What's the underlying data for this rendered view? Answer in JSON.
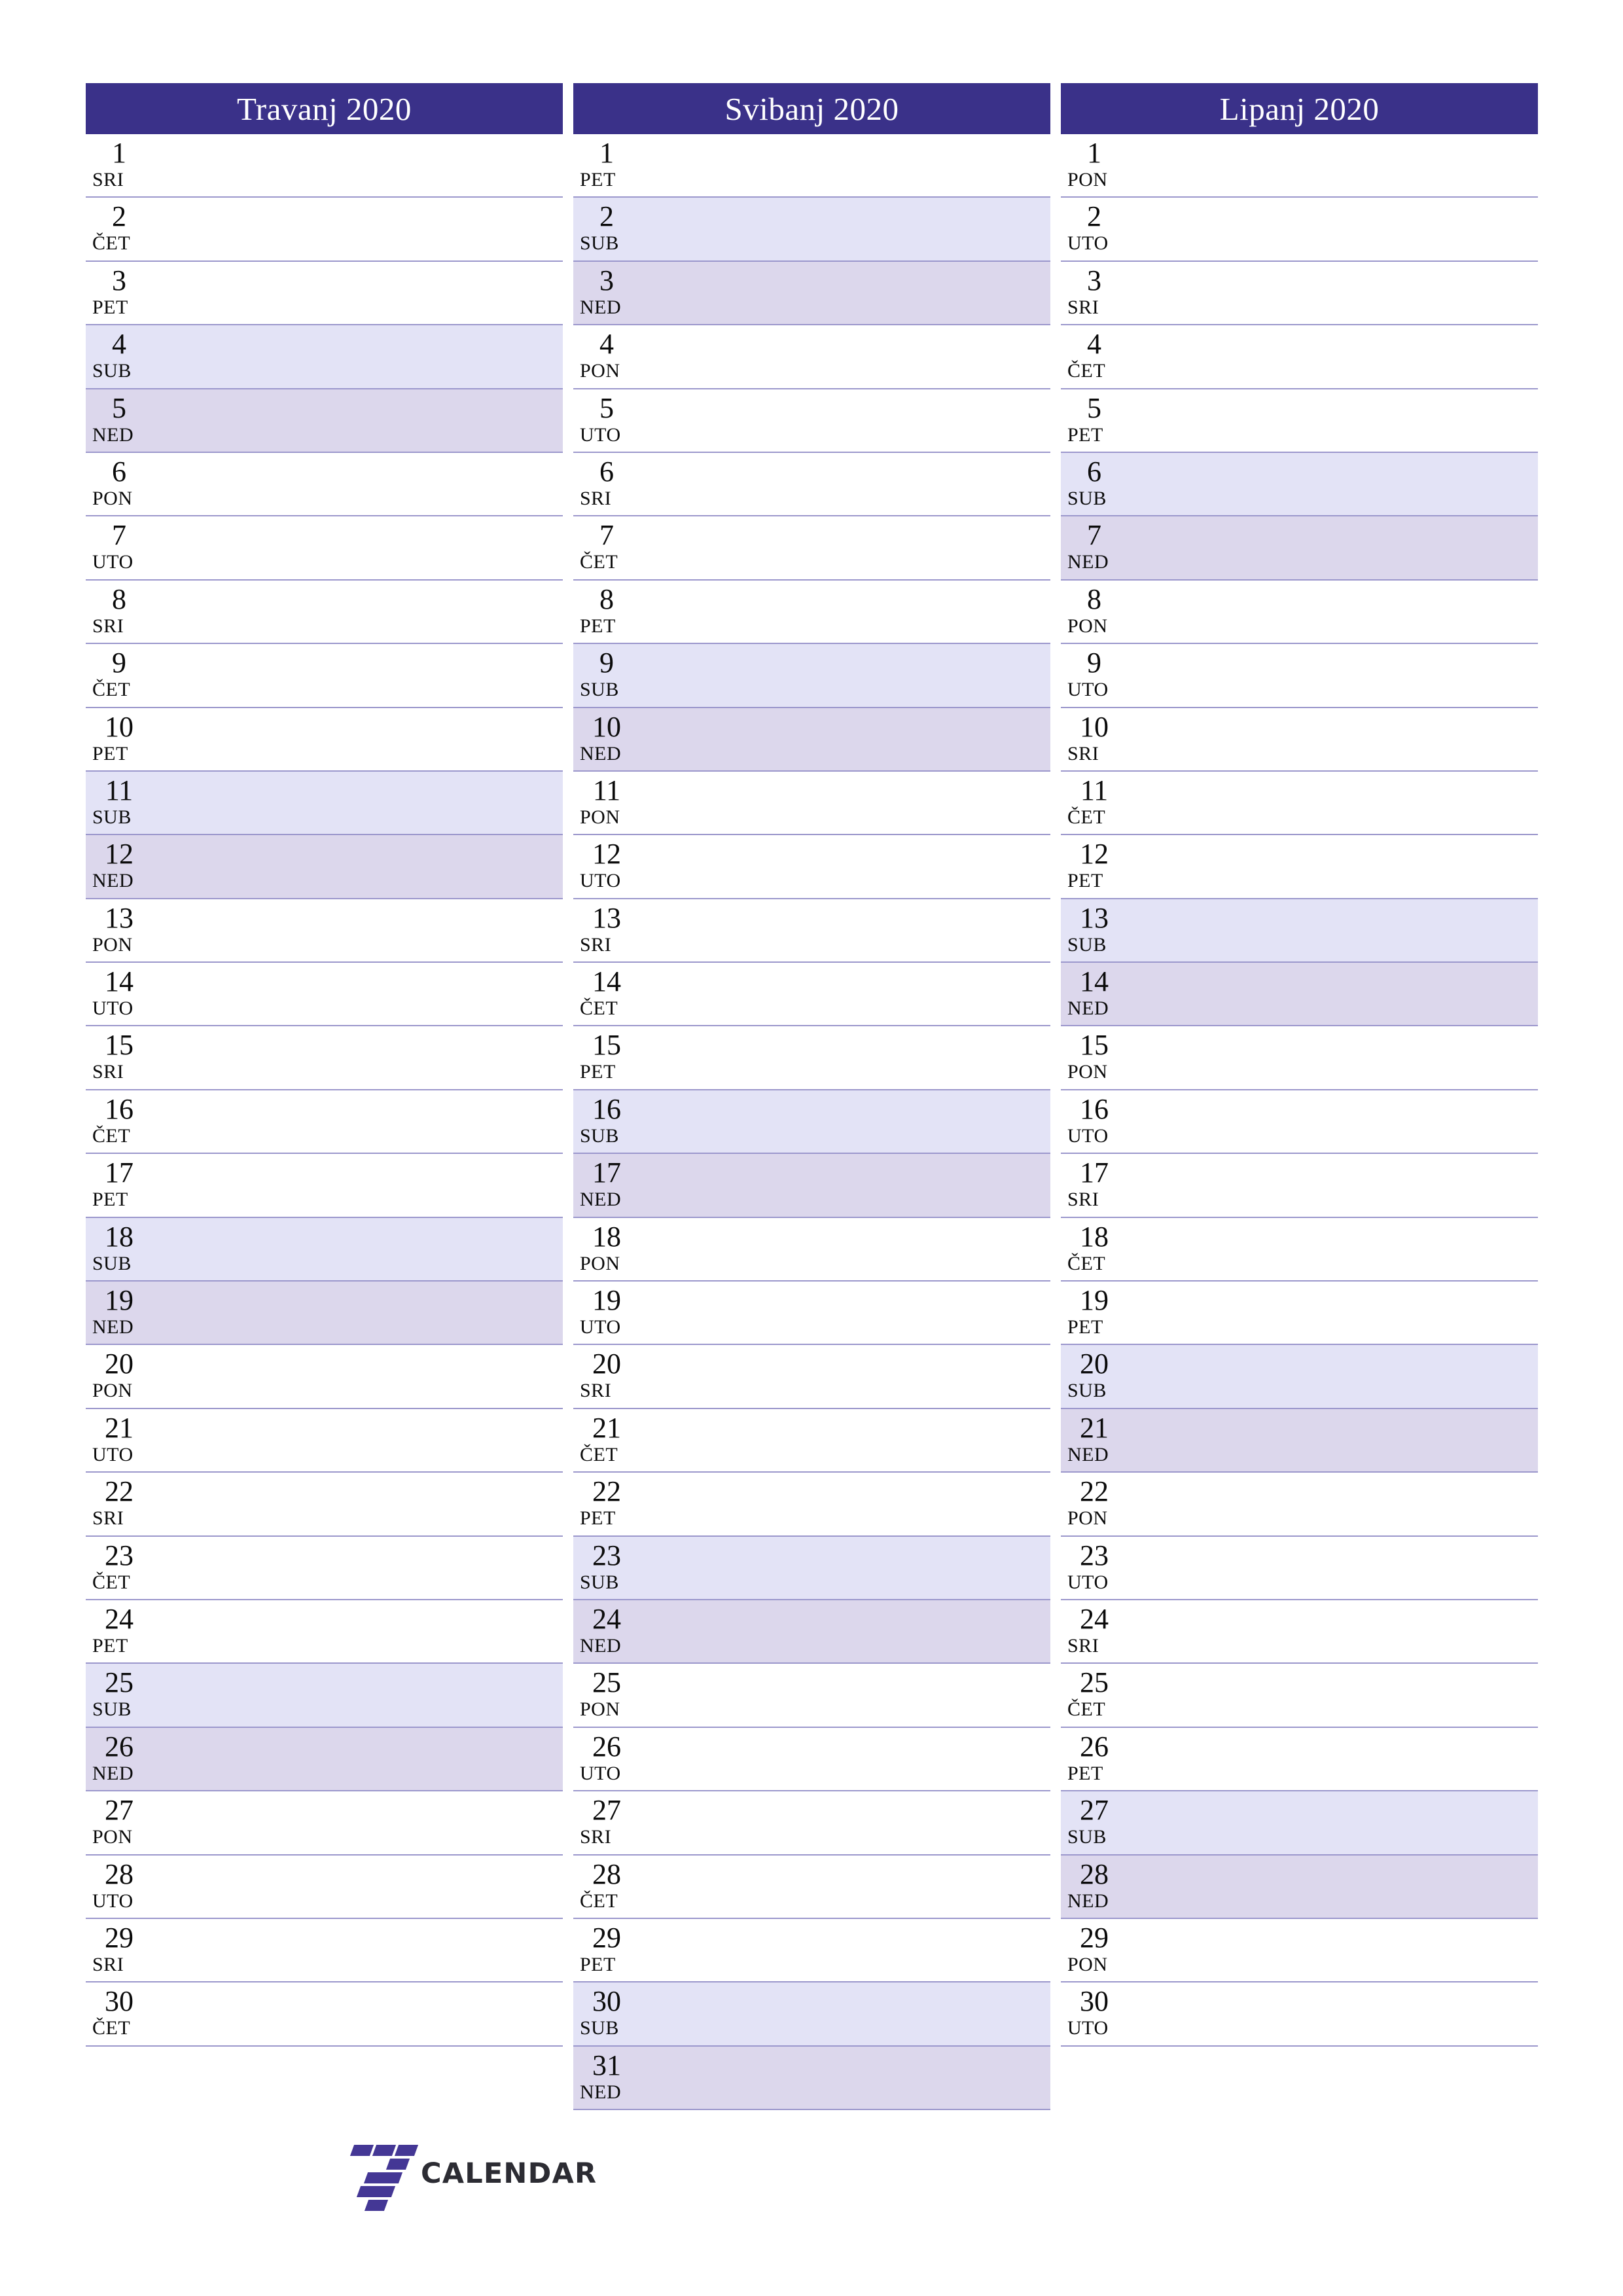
{
  "page": {
    "accent_color": "#3a3189",
    "saturday_color": "#e3e3f6",
    "sunday_color": "#dcd7ec",
    "row_separator_color": "#9b97cc",
    "text_color": "#0b0b0b"
  },
  "brand": {
    "name": "CALENDAR",
    "mark_colors": [
      "#f4003c",
      "#443795"
    ],
    "mark_icon": "seven-blocks-icon"
  },
  "months": [
    {
      "title": "Travanj 2020",
      "days": [
        {
          "num": "1",
          "weekday": "SRI",
          "type": "weekday"
        },
        {
          "num": "2",
          "weekday": "ČET",
          "type": "weekday"
        },
        {
          "num": "3",
          "weekday": "PET",
          "type": "weekday"
        },
        {
          "num": "4",
          "weekday": "SUB",
          "type": "saturday"
        },
        {
          "num": "5",
          "weekday": "NED",
          "type": "sunday"
        },
        {
          "num": "6",
          "weekday": "PON",
          "type": "weekday"
        },
        {
          "num": "7",
          "weekday": "UTO",
          "type": "weekday"
        },
        {
          "num": "8",
          "weekday": "SRI",
          "type": "weekday"
        },
        {
          "num": "9",
          "weekday": "ČET",
          "type": "weekday"
        },
        {
          "num": "10",
          "weekday": "PET",
          "type": "weekday"
        },
        {
          "num": "11",
          "weekday": "SUB",
          "type": "saturday"
        },
        {
          "num": "12",
          "weekday": "NED",
          "type": "sunday"
        },
        {
          "num": "13",
          "weekday": "PON",
          "type": "weekday"
        },
        {
          "num": "14",
          "weekday": "UTO",
          "type": "weekday"
        },
        {
          "num": "15",
          "weekday": "SRI",
          "type": "weekday"
        },
        {
          "num": "16",
          "weekday": "ČET",
          "type": "weekday"
        },
        {
          "num": "17",
          "weekday": "PET",
          "type": "weekday"
        },
        {
          "num": "18",
          "weekday": "SUB",
          "type": "saturday"
        },
        {
          "num": "19",
          "weekday": "NED",
          "type": "sunday"
        },
        {
          "num": "20",
          "weekday": "PON",
          "type": "weekday"
        },
        {
          "num": "21",
          "weekday": "UTO",
          "type": "weekday"
        },
        {
          "num": "22",
          "weekday": "SRI",
          "type": "weekday"
        },
        {
          "num": "23",
          "weekday": "ČET",
          "type": "weekday"
        },
        {
          "num": "24",
          "weekday": "PET",
          "type": "weekday"
        },
        {
          "num": "25",
          "weekday": "SUB",
          "type": "saturday"
        },
        {
          "num": "26",
          "weekday": "NED",
          "type": "sunday"
        },
        {
          "num": "27",
          "weekday": "PON",
          "type": "weekday"
        },
        {
          "num": "28",
          "weekday": "UTO",
          "type": "weekday"
        },
        {
          "num": "29",
          "weekday": "SRI",
          "type": "weekday"
        },
        {
          "num": "30",
          "weekday": "ČET",
          "type": "weekday"
        }
      ]
    },
    {
      "title": "Svibanj 2020",
      "days": [
        {
          "num": "1",
          "weekday": "PET",
          "type": "weekday"
        },
        {
          "num": "2",
          "weekday": "SUB",
          "type": "saturday"
        },
        {
          "num": "3",
          "weekday": "NED",
          "type": "sunday"
        },
        {
          "num": "4",
          "weekday": "PON",
          "type": "weekday"
        },
        {
          "num": "5",
          "weekday": "UTO",
          "type": "weekday"
        },
        {
          "num": "6",
          "weekday": "SRI",
          "type": "weekday"
        },
        {
          "num": "7",
          "weekday": "ČET",
          "type": "weekday"
        },
        {
          "num": "8",
          "weekday": "PET",
          "type": "weekday"
        },
        {
          "num": "9",
          "weekday": "SUB",
          "type": "saturday"
        },
        {
          "num": "10",
          "weekday": "NED",
          "type": "sunday"
        },
        {
          "num": "11",
          "weekday": "PON",
          "type": "weekday"
        },
        {
          "num": "12",
          "weekday": "UTO",
          "type": "weekday"
        },
        {
          "num": "13",
          "weekday": "SRI",
          "type": "weekday"
        },
        {
          "num": "14",
          "weekday": "ČET",
          "type": "weekday"
        },
        {
          "num": "15",
          "weekday": "PET",
          "type": "weekday"
        },
        {
          "num": "16",
          "weekday": "SUB",
          "type": "saturday"
        },
        {
          "num": "17",
          "weekday": "NED",
          "type": "sunday"
        },
        {
          "num": "18",
          "weekday": "PON",
          "type": "weekday"
        },
        {
          "num": "19",
          "weekday": "UTO",
          "type": "weekday"
        },
        {
          "num": "20",
          "weekday": "SRI",
          "type": "weekday"
        },
        {
          "num": "21",
          "weekday": "ČET",
          "type": "weekday"
        },
        {
          "num": "22",
          "weekday": "PET",
          "type": "weekday"
        },
        {
          "num": "23",
          "weekday": "SUB",
          "type": "saturday"
        },
        {
          "num": "24",
          "weekday": "NED",
          "type": "sunday"
        },
        {
          "num": "25",
          "weekday": "PON",
          "type": "weekday"
        },
        {
          "num": "26",
          "weekday": "UTO",
          "type": "weekday"
        },
        {
          "num": "27",
          "weekday": "SRI",
          "type": "weekday"
        },
        {
          "num": "28",
          "weekday": "ČET",
          "type": "weekday"
        },
        {
          "num": "29",
          "weekday": "PET",
          "type": "weekday"
        },
        {
          "num": "30",
          "weekday": "SUB",
          "type": "saturday"
        },
        {
          "num": "31",
          "weekday": "NED",
          "type": "sunday"
        }
      ]
    },
    {
      "title": "Lipanj 2020",
      "days": [
        {
          "num": "1",
          "weekday": "PON",
          "type": "weekday"
        },
        {
          "num": "2",
          "weekday": "UTO",
          "type": "weekday"
        },
        {
          "num": "3",
          "weekday": "SRI",
          "type": "weekday"
        },
        {
          "num": "4",
          "weekday": "ČET",
          "type": "weekday"
        },
        {
          "num": "5",
          "weekday": "PET",
          "type": "weekday"
        },
        {
          "num": "6",
          "weekday": "SUB",
          "type": "saturday"
        },
        {
          "num": "7",
          "weekday": "NED",
          "type": "sunday"
        },
        {
          "num": "8",
          "weekday": "PON",
          "type": "weekday"
        },
        {
          "num": "9",
          "weekday": "UTO",
          "type": "weekday"
        },
        {
          "num": "10",
          "weekday": "SRI",
          "type": "weekday"
        },
        {
          "num": "11",
          "weekday": "ČET",
          "type": "weekday"
        },
        {
          "num": "12",
          "weekday": "PET",
          "type": "weekday"
        },
        {
          "num": "13",
          "weekday": "SUB",
          "type": "saturday"
        },
        {
          "num": "14",
          "weekday": "NED",
          "type": "sunday"
        },
        {
          "num": "15",
          "weekday": "PON",
          "type": "weekday"
        },
        {
          "num": "16",
          "weekday": "UTO",
          "type": "weekday"
        },
        {
          "num": "17",
          "weekday": "SRI",
          "type": "weekday"
        },
        {
          "num": "18",
          "weekday": "ČET",
          "type": "weekday"
        },
        {
          "num": "19",
          "weekday": "PET",
          "type": "weekday"
        },
        {
          "num": "20",
          "weekday": "SUB",
          "type": "saturday"
        },
        {
          "num": "21",
          "weekday": "NED",
          "type": "sunday"
        },
        {
          "num": "22",
          "weekday": "PON",
          "type": "weekday"
        },
        {
          "num": "23",
          "weekday": "UTO",
          "type": "weekday"
        },
        {
          "num": "24",
          "weekday": "SRI",
          "type": "weekday"
        },
        {
          "num": "25",
          "weekday": "ČET",
          "type": "weekday"
        },
        {
          "num": "26",
          "weekday": "PET",
          "type": "weekday"
        },
        {
          "num": "27",
          "weekday": "SUB",
          "type": "saturday"
        },
        {
          "num": "28",
          "weekday": "NED",
          "type": "sunday"
        },
        {
          "num": "29",
          "weekday": "PON",
          "type": "weekday"
        },
        {
          "num": "30",
          "weekday": "UTO",
          "type": "weekday"
        }
      ]
    }
  ]
}
